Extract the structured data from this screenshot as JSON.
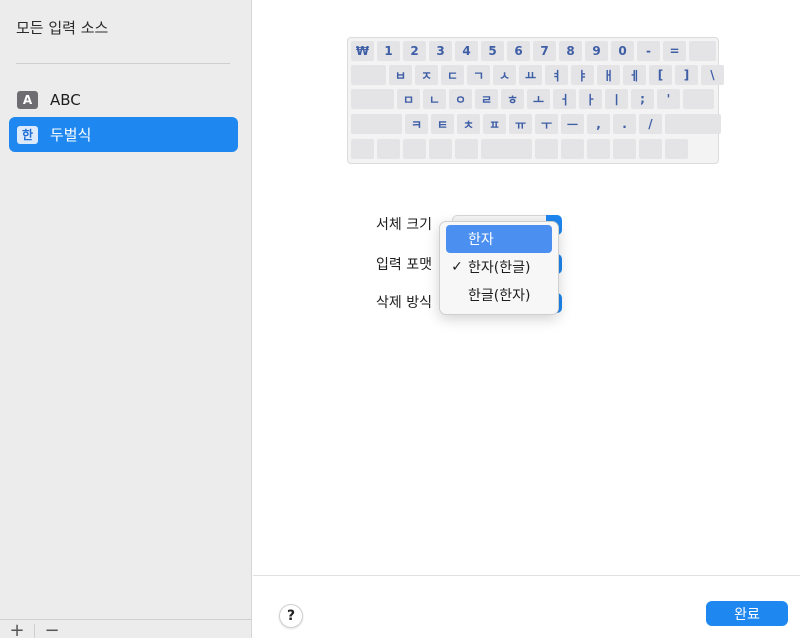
{
  "sidebar": {
    "title": "모든 입력 소스",
    "items": [
      {
        "badge": "A",
        "label": "ABC",
        "selected": false
      },
      {
        "badge": "한",
        "label": "두벌식",
        "selected": true
      }
    ],
    "footer": {
      "add_label": "+",
      "remove_label": "−"
    }
  },
  "keyboard": {
    "rows": [
      [
        "₩",
        "1",
        "2",
        "3",
        "4",
        "5",
        "6",
        "7",
        "8",
        "9",
        "0",
        "-",
        "=",
        ""
      ],
      [
        "",
        "ㅂ",
        "ㅈ",
        "ㄷ",
        "ㄱ",
        "ㅅ",
        "ㅛ",
        "ㅕ",
        "ㅑ",
        "ㅐ",
        "ㅔ",
        "[",
        "]",
        "\\"
      ],
      [
        "",
        "ㅁ",
        "ㄴ",
        "ㅇ",
        "ㄹ",
        "ㅎ",
        "ㅗ",
        "ㅓ",
        "ㅏ",
        "ㅣ",
        ";",
        "'",
        ""
      ],
      [
        "",
        "ㅋ",
        "ㅌ",
        "ㅊ",
        "ㅍ",
        "ㅠ",
        "ㅜ",
        "ㅡ",
        ",",
        ".",
        "/",
        ""
      ],
      [
        "",
        "",
        "",
        "",
        "",
        "",
        "",
        "",
        "",
        "",
        "",
        ""
      ]
    ]
  },
  "options": {
    "font_size_label": "서체 크기",
    "input_format_label": "입력 포맷",
    "delete_mode_label": "삭제 방식"
  },
  "menu": {
    "items": [
      {
        "label": "한자",
        "checked": false,
        "highlighted": true
      },
      {
        "label": "한자(한글)",
        "checked": true,
        "highlighted": false
      },
      {
        "label": "한글(한자)",
        "checked": false,
        "highlighted": false
      }
    ],
    "check_glyph": "✓"
  },
  "footer": {
    "help_label": "?",
    "done_label": "완료"
  },
  "colors": {
    "accent": "#1e87f0",
    "menu_highlight": "#4b8ff0"
  }
}
